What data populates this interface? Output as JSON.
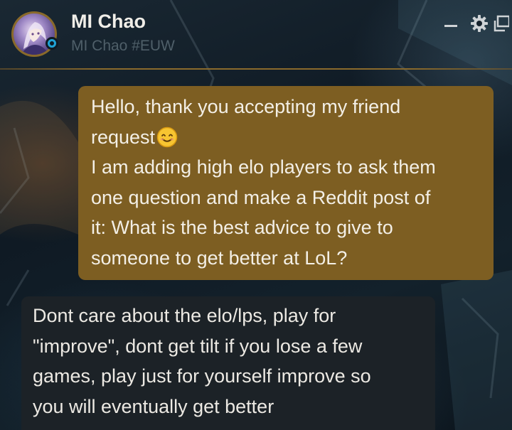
{
  "header": {
    "display_name": "MI Chao",
    "riot_id": "MI Chao #EUW",
    "status": "online"
  },
  "controls": {
    "minimize_icon": "minimize-icon",
    "settings_icon": "gear-icon",
    "popout_icon": "popout-icon"
  },
  "messages": [
    {
      "direction": "outgoing",
      "lines": [
        "Hello, thank you accepting my friend",
        "request",
        "I am adding high elo players to ask them",
        "one question and make a Reddit post of",
        "it: What is the best advice to give to",
        "someone to get better at LoL?"
      ],
      "emoji": "smiling-face-emoji"
    },
    {
      "direction": "incoming",
      "lines": [
        "Dont care about the elo/lps, play for",
        "\"improve\", dont get tilt if you lose a few",
        "games, play just for yourself improve so",
        "you will eventually get better"
      ]
    }
  ],
  "colors": {
    "outgoing_bubble": "#7d5e22",
    "incoming_bubble": "#1c2227",
    "accent_gold": "#8a6a2c",
    "status_blue": "#1fa3d6"
  }
}
